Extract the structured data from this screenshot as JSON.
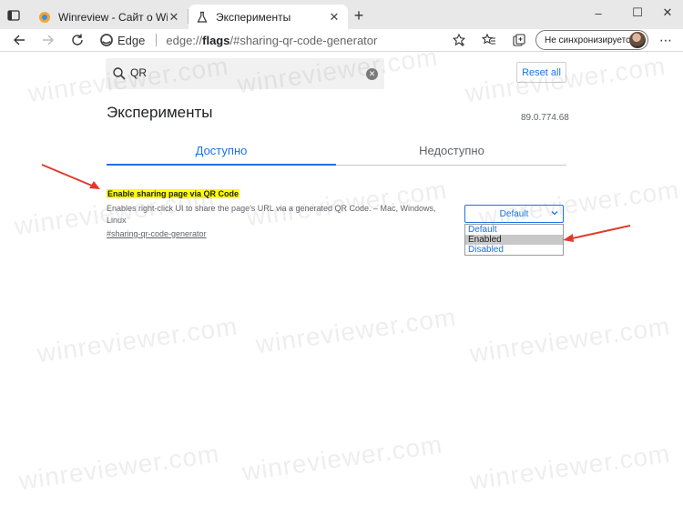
{
  "browser": {
    "tabs": [
      {
        "title": "Winreview - Сайт о Windows",
        "active": false,
        "favicon": "winreview-favicon-icon"
      },
      {
        "title": "Эксперименты",
        "active": true,
        "favicon": "flask-icon"
      }
    ],
    "new_tab_label": "+",
    "window_controls": {
      "minimize": "–",
      "maximize": "☐",
      "close": "✕"
    },
    "toolbar": {
      "site_label": "Edge",
      "url_scheme": "edge://",
      "url_host": "flags",
      "url_rest": "/#sharing-qr-code-generator",
      "profile_label": "Не синхронизируется"
    }
  },
  "flags_page": {
    "search_query": "QR",
    "reset_label": "Reset all",
    "title": "Эксперименты",
    "version": "89.0.774.68",
    "tab_available": "Доступно",
    "tab_unavailable": "Недоступно",
    "flag": {
      "name": "Enable sharing page via QR Code",
      "description": "Enables right-click UI to share the page's URL via a generated QR Code. – Mac, Windows, Linux",
      "link": "#sharing-qr-code-generator",
      "select_value": "Default",
      "options": [
        "Default",
        "Enabled",
        "Disabled"
      ],
      "highlighted_option": "Enabled"
    }
  },
  "watermark": "winreviewer.com",
  "colors": {
    "accent": "#1a73e8",
    "highlight": "#ffff00",
    "arrow": "#e03a2f",
    "tabstrip": "#e8e8e8"
  }
}
